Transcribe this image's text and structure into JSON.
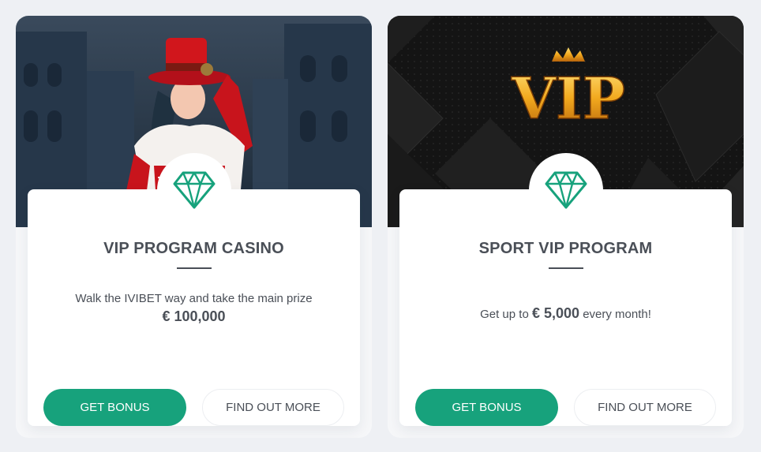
{
  "colors": {
    "accent": "#17a27c",
    "text": "#4a4f57",
    "background": "#eef0f4"
  },
  "cards": [
    {
      "banner": "casino-banner-image",
      "icon": "diamond-icon",
      "title": "VIP PROGRAM CASINO",
      "desc_line1": "Walk the IVIBET way and take the main prize",
      "amount": "€ 100,000",
      "get_bonus_label": "GET BONUS",
      "find_out_more_label": "FIND OUT MORE"
    },
    {
      "banner": "vip-logo-banner-image",
      "banner_logo_text": "VIP",
      "icon": "diamond-icon",
      "title": "SPORT VIP PROGRAM",
      "desc_prefix": "Get up to",
      "amount": "€ 5,000",
      "desc_suffix": "every month!",
      "get_bonus_label": "GET BONUS",
      "find_out_more_label": "FIND OUT MORE"
    }
  ]
}
